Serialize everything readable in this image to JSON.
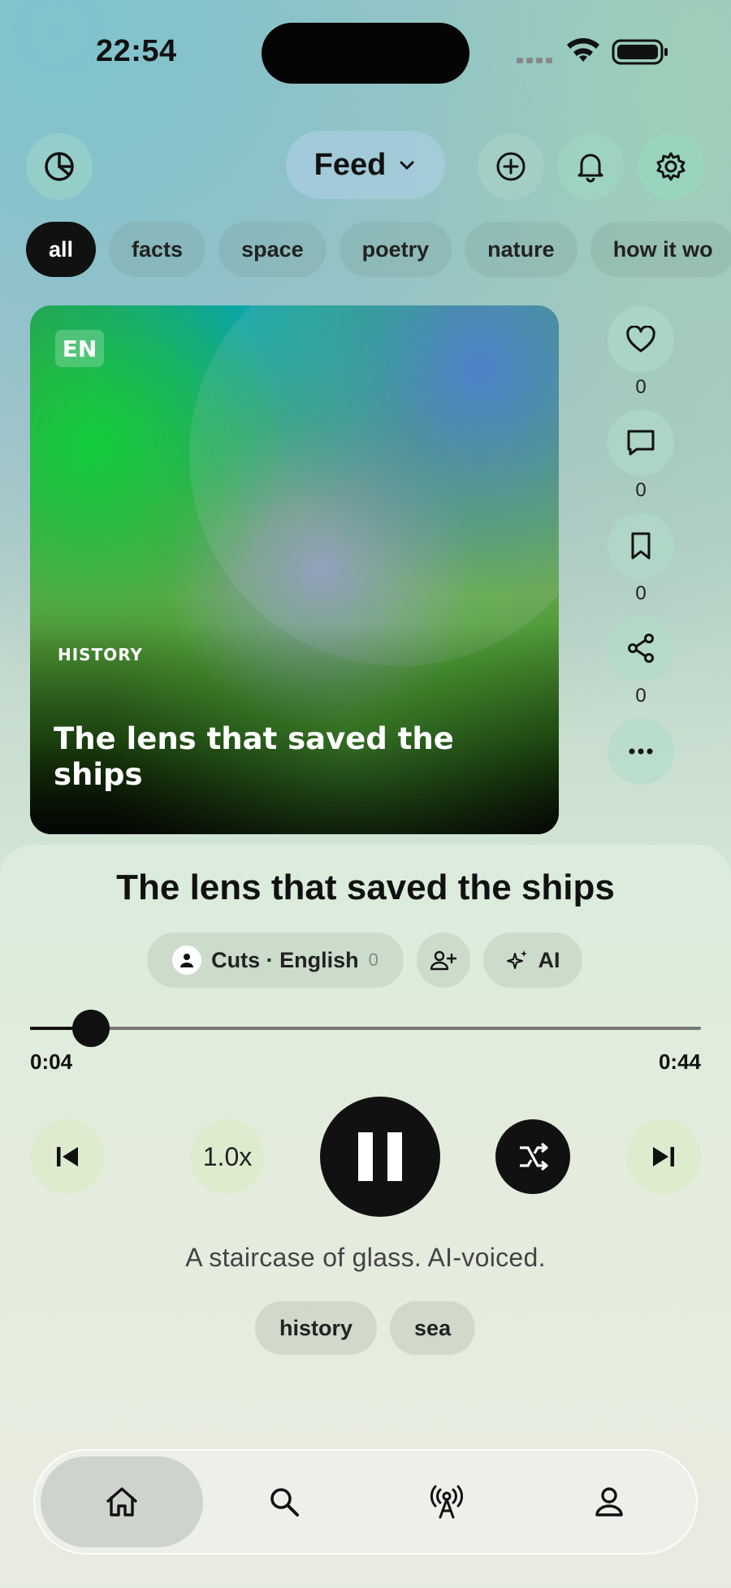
{
  "status_bar": {
    "time": "22:54"
  },
  "header": {
    "feed_label": "Feed",
    "icons": [
      "logo-icon",
      "chevron-down-icon",
      "add-icon",
      "bell-icon",
      "gear-icon"
    ]
  },
  "chips": [
    "all",
    "facts",
    "space",
    "poetry",
    "nature",
    "how it wo"
  ],
  "card": {
    "lang": "EN",
    "category": "HISTORY",
    "title": "The lens that saved the ships"
  },
  "actions": {
    "like_count": "0",
    "comment_count": "0",
    "save_count": "0",
    "share_count": "0"
  },
  "player": {
    "title": "The lens that saved the ships",
    "voice_label": "Cuts · English",
    "voice_count": "0",
    "ai_label": "AI",
    "elapsed": "0:04",
    "duration": "0:44",
    "progress": 0.0909,
    "speed": "1.0x",
    "description": "A staircase of glass. AI-voiced.",
    "tags": [
      "history",
      "sea"
    ]
  },
  "tabbar": {
    "items": [
      "home-icon",
      "search-icon",
      "broadcast-icon",
      "profile-icon"
    ],
    "active": "home"
  },
  "colors": {
    "accent": "#111111",
    "chip_active_text": "#ffffff"
  }
}
